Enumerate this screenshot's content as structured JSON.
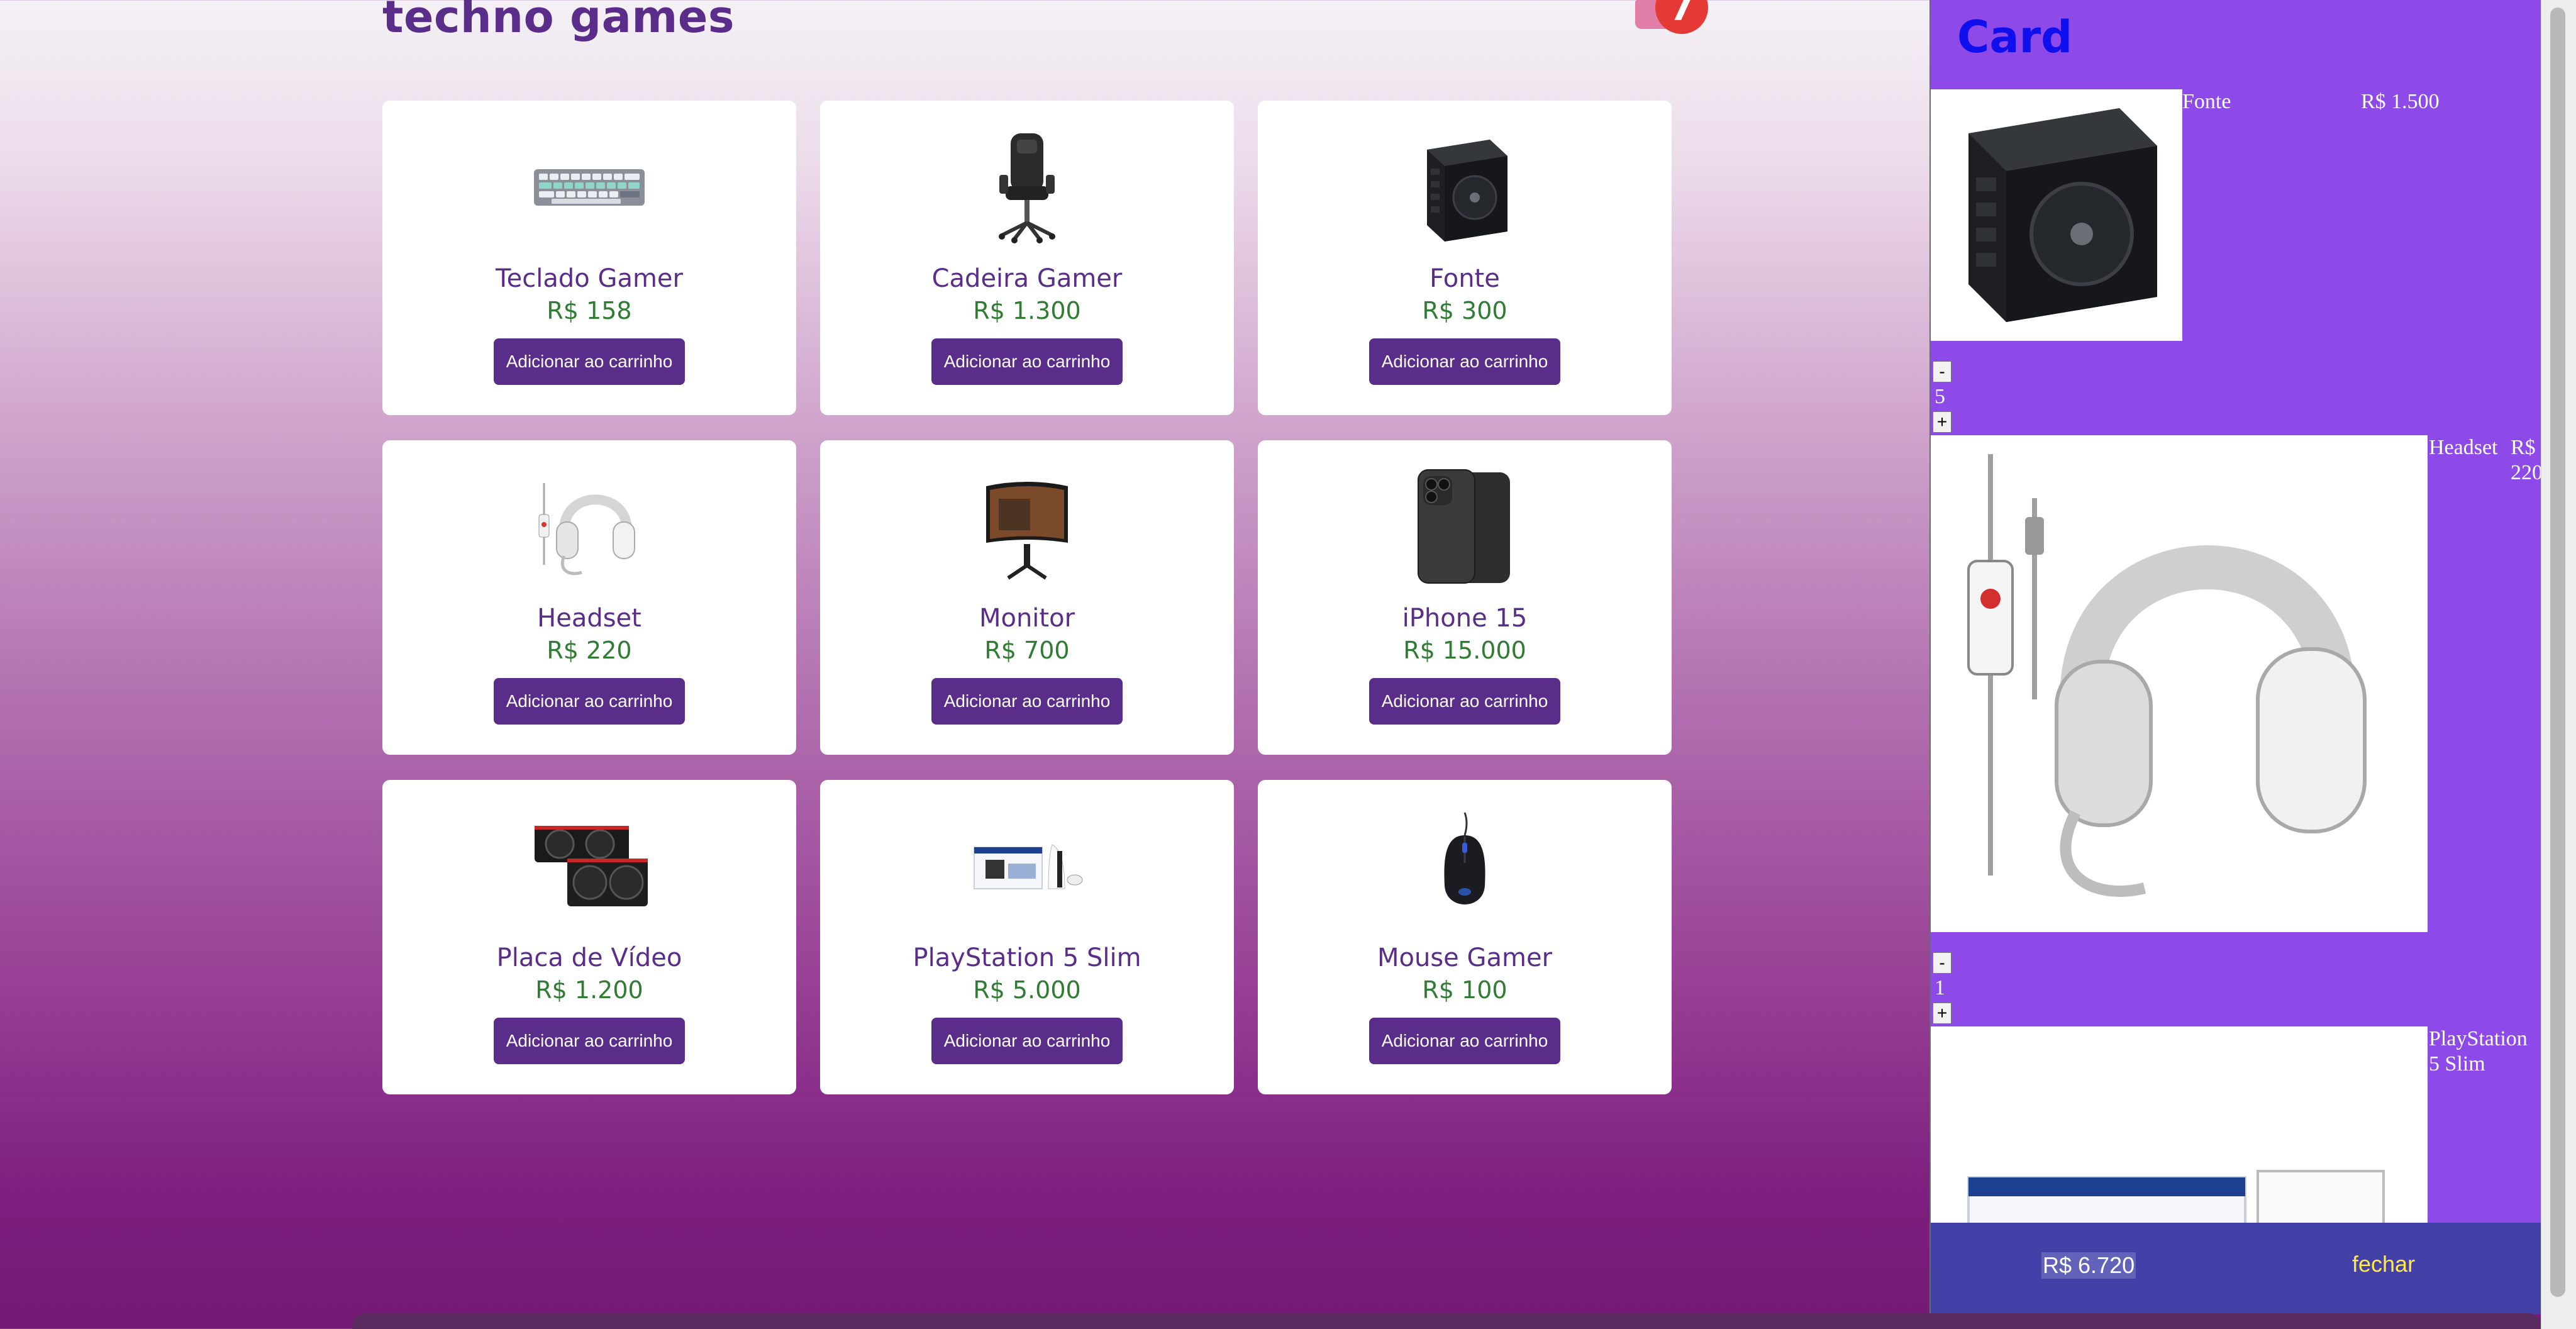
{
  "header": {
    "title": "techno games",
    "cart_count": "7"
  },
  "products": [
    {
      "name": "Teclado Gamer",
      "price": "R$ 158",
      "button": "Adicionar ao carrinho",
      "image": "keyboard-image"
    },
    {
      "name": "Cadeira Gamer",
      "price": "R$ 1.300",
      "button": "Adicionar ao carrinho",
      "image": "gaming-chair-image"
    },
    {
      "name": "Fonte",
      "price": "R$ 300",
      "button": "Adicionar ao carrinho",
      "image": "power-supply-image"
    },
    {
      "name": "Headset",
      "price": "R$ 220",
      "button": "Adicionar ao carrinho",
      "image": "headset-image"
    },
    {
      "name": "Monitor",
      "price": "R$ 700",
      "button": "Adicionar ao carrinho",
      "image": "monitor-image"
    },
    {
      "name": "iPhone 15",
      "price": "R$ 15.000",
      "button": "Adicionar ao carrinho",
      "image": "smartphone-image"
    },
    {
      "name": "Placa de Vídeo",
      "price": "R$ 1.200",
      "button": "Adicionar ao carrinho",
      "image": "graphics-card-image"
    },
    {
      "name": "PlayStation 5 Slim",
      "price": "R$ 5.000",
      "button": "Adicionar ao carrinho",
      "image": "console-image"
    },
    {
      "name": "Mouse Gamer",
      "price": "R$ 100",
      "button": "Adicionar ao carrinho",
      "image": "mouse-image"
    }
  ],
  "cart": {
    "heading": "Card",
    "items": [
      {
        "name": "Fonte",
        "price": "R$ 1.500",
        "quantity": "5",
        "minus": "-",
        "plus": "+"
      },
      {
        "name": "Headset",
        "price": "R$ 220",
        "quantity": "1",
        "minus": "-",
        "plus": "+"
      },
      {
        "name": "PlayStation 5 Slim",
        "price": ""
      }
    ],
    "total": "R$ 6.720",
    "close_label": "fechar"
  },
  "colors": {
    "brand": "#5b2d8b",
    "price": "#2e7d32",
    "cart_panel": "#8e4ae8",
    "cart_footer": "#4341a8",
    "badge": "#e53935"
  }
}
